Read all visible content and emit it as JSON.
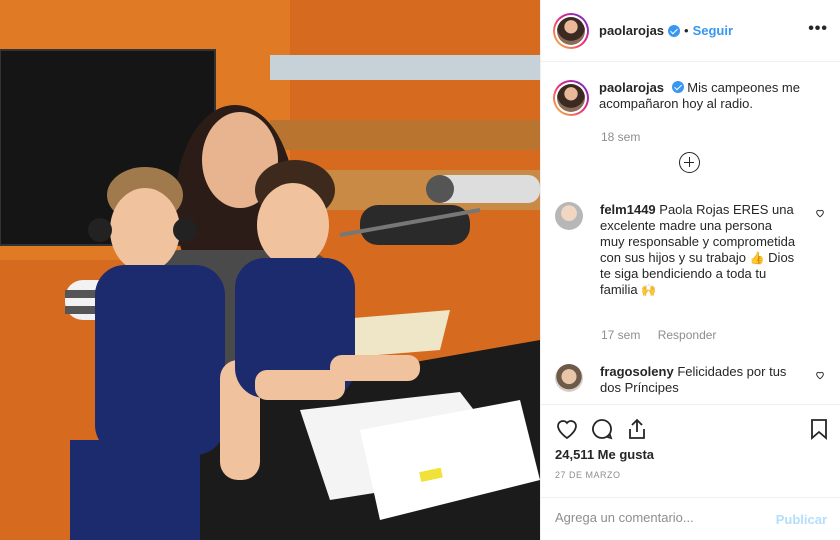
{
  "post": {
    "username": "paolarojas",
    "follow_label": "Seguir",
    "separator": "•",
    "more_label": "•••",
    "caption_text": "Mis campeones me acompañaron hoy al radio.",
    "caption_time": "18 sem",
    "photo_alt": "photo"
  },
  "comments": [
    {
      "username": "felm1449",
      "text": "Paola Rojas ERES una excelente madre una persona muy responsable y comprometida con sus hijos y su trabajo",
      "emoji1": "👍",
      "text2": "Dios te siga bendiciendo a toda tu familia",
      "emoji2": "🙌",
      "time": "17 sem",
      "reply_label": "Responder"
    },
    {
      "username": "fragosoleny",
      "text": "Felicidades por tus dos Príncipes"
    }
  ],
  "actions": {
    "likes": "24,511 Me gusta",
    "date": "27 DE MARZO",
    "comment_placeholder": "Agrega un comentario...",
    "publish_label": "Publicar"
  },
  "icons": {
    "like": "heart-icon",
    "comment": "comment-icon",
    "share": "share-icon",
    "save": "bookmark-icon",
    "verified": "verified-badge-icon"
  },
  "colors": {
    "link_blue": "#3897f0",
    "publish_disabled": "#b2dffc",
    "muted": "#8e8e8e"
  }
}
